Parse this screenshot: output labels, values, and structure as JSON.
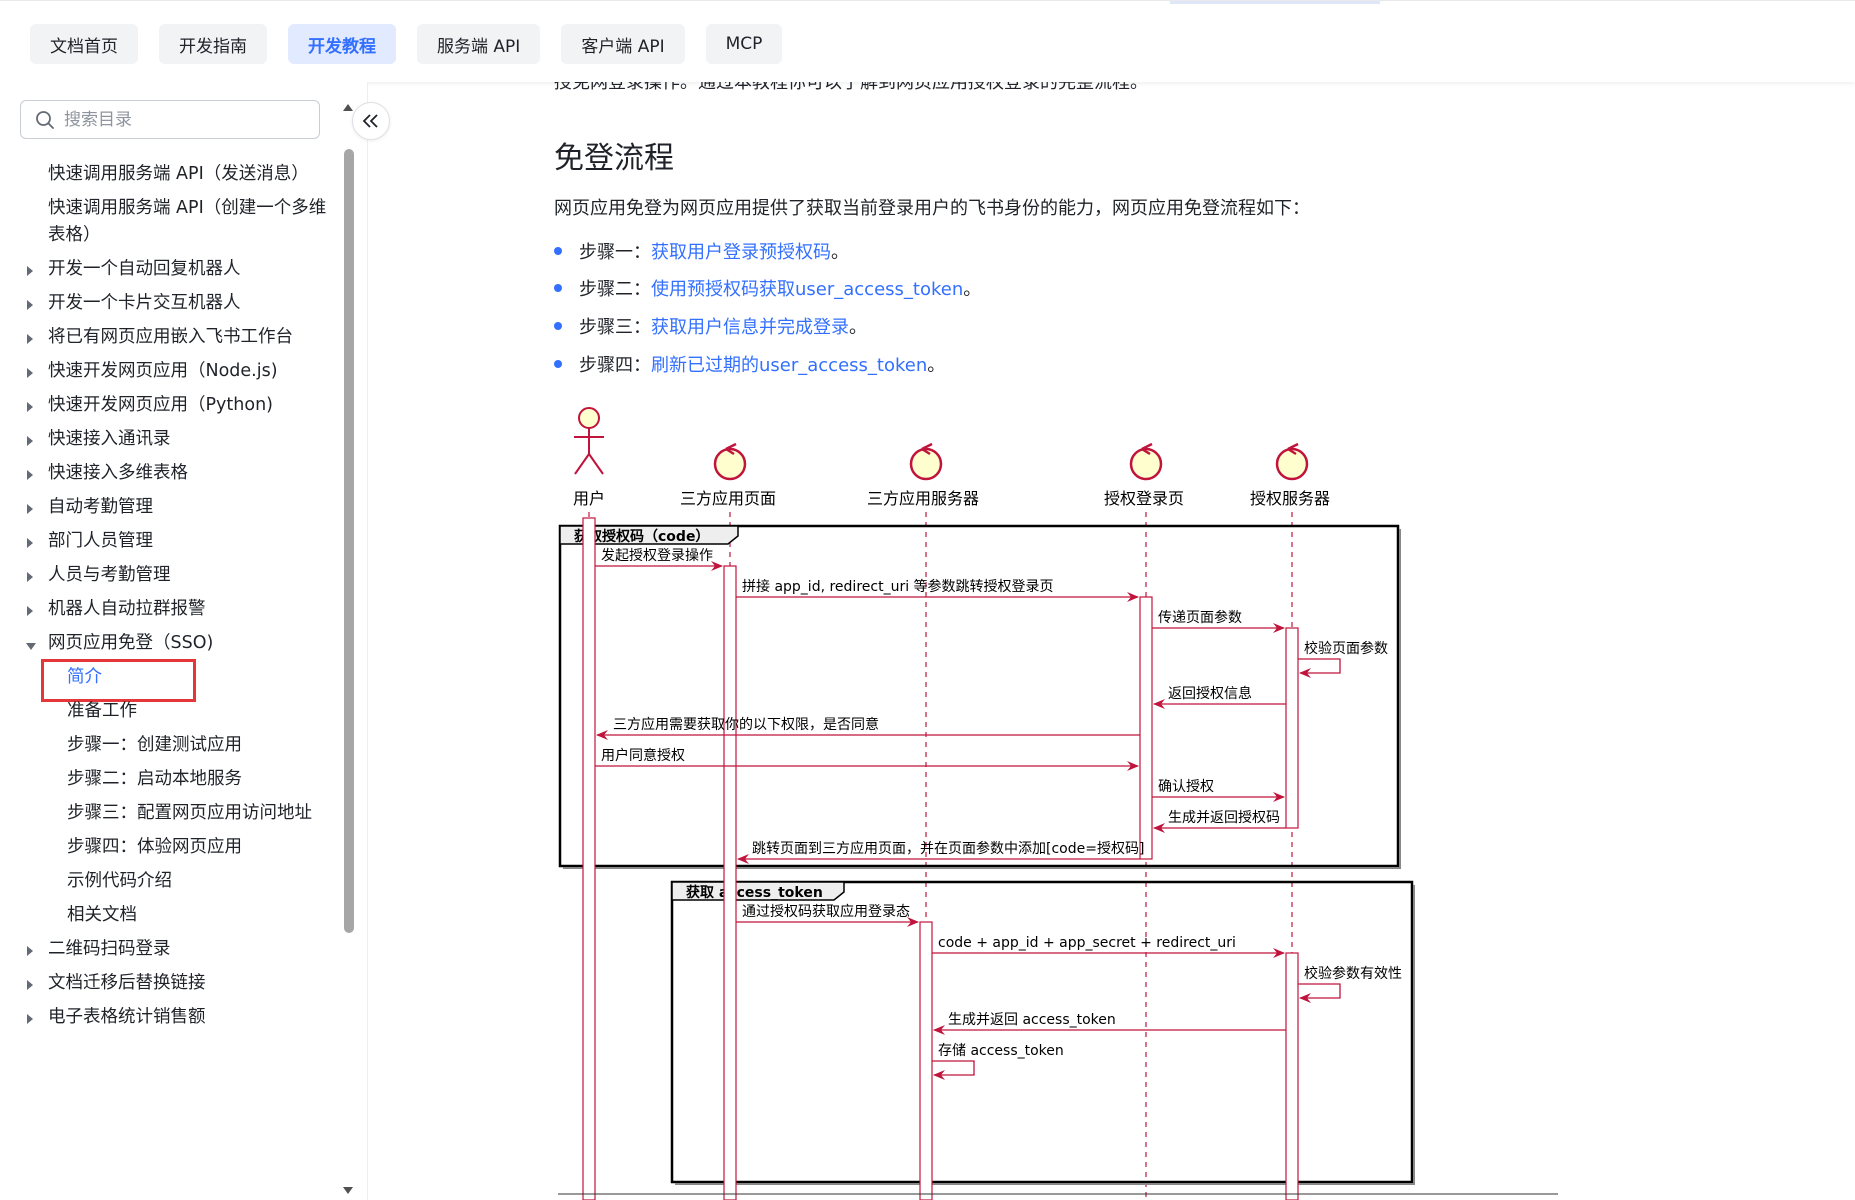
{
  "topnav": {
    "tabs": [
      {
        "label": "文档首页",
        "active": false
      },
      {
        "label": "开发指南",
        "active": false
      },
      {
        "label": "开发教程",
        "active": true
      },
      {
        "label": "服务端 API",
        "active": false
      },
      {
        "label": "客户端 API",
        "active": false
      },
      {
        "label": "MCP",
        "active": false
      }
    ]
  },
  "sidebar": {
    "search_placeholder": "搜索目录",
    "items": [
      "快速调用服务端 API（发送消息）",
      "快速调用服务端 API（创建一个多维表格）",
      "开发一个自动回复机器人",
      "开发一个卡片交互机器人",
      "将已有网页应用嵌入飞书工作台",
      "快速开发网页应用（Node.js)",
      "快速开发网页应用（Python)",
      "快速接入通讯录",
      "快速接入多维表格",
      "自动考勤管理",
      "部门人员管理",
      "人员与考勤管理",
      "机器人自动拉群报警",
      "网页应用免登（SSO)",
      "简介",
      "准备工作",
      "步骤一：创建测试应用",
      "步骤二：启动本地服务",
      "步骤三：配置网页应用访问地址",
      "步骤四：体验网页应用",
      "示例代码介绍",
      "相关文档",
      "二维码扫码登录",
      "文档迁移后替换链接",
      "电子表格统计销售额"
    ]
  },
  "main": {
    "cut_text": "授免网登录操作。通过本教程你可以了解到网页应用授权登录的完整流程。",
    "section_title": "免登流程",
    "intro": "网页应用免登为网页应用提供了获取当前登录用户的飞书身份的能力，网页应用免登流程如下：",
    "steps": [
      {
        "prefix": "步骤一：",
        "link": "获取用户登录预授权码",
        "suffix": "。"
      },
      {
        "prefix": "步骤二：",
        "link": "使用预授权码获取user_access_token",
        "suffix": "。"
      },
      {
        "prefix": "步骤三：",
        "link": "获取用户信息并完成登录",
        "suffix": "。"
      },
      {
        "prefix": "步骤四：",
        "link": "刷新已过期的user_access_token",
        "suffix": "。"
      }
    ]
  },
  "diagram": {
    "participants": [
      "用户",
      "三方应用页面",
      "三方应用服务器",
      "授权登录页",
      "授权服务器"
    ],
    "group1_title": "获取授权码（code）",
    "group2_title": "获取 access_token",
    "messages": {
      "m1": "发起授权登录操作",
      "m2": "拼接 app_id, redirect_uri 等参数跳转授权登录页",
      "m3": "传递页面参数",
      "m4": "校验页面参数",
      "m5": "返回授权信息",
      "m6": "三方应用需要获取你的以下权限，是否同意",
      "m7": "用户同意授权",
      "m8": "确认授权",
      "m9": "生成并返回授权码",
      "m10": "跳转页面到三方应用页面，并在页面参数中添加[code=授权码]",
      "m11": "通过授权码获取应用登录态",
      "m12": "code + app_id + app_secret + redirect_uri",
      "m13": "校验参数有效性",
      "m14": "生成并返回 access_token",
      "m15": "存储 access_token"
    },
    "colors": {
      "line": "#c0143c",
      "box_fill": "#fefece",
      "text": "#000000"
    }
  }
}
